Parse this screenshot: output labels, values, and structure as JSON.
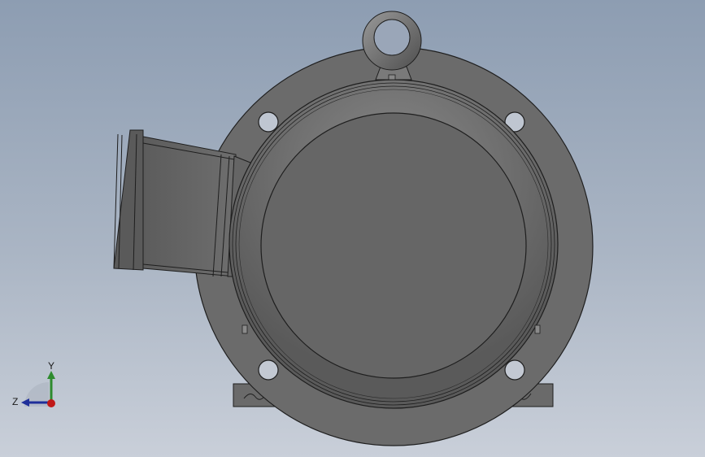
{
  "viewport": {
    "background_top": "#8d9db2",
    "background_bottom": "#c9cfd9",
    "model": "motor-end-view",
    "body_color": "#6a6a6a",
    "edge_color": "#1e1e1e"
  },
  "triad": {
    "y_label": "Y",
    "z_label": "Z",
    "y_color": "#2e8b2e",
    "z_color": "#1f2f9a",
    "x_color": "#c01818"
  }
}
